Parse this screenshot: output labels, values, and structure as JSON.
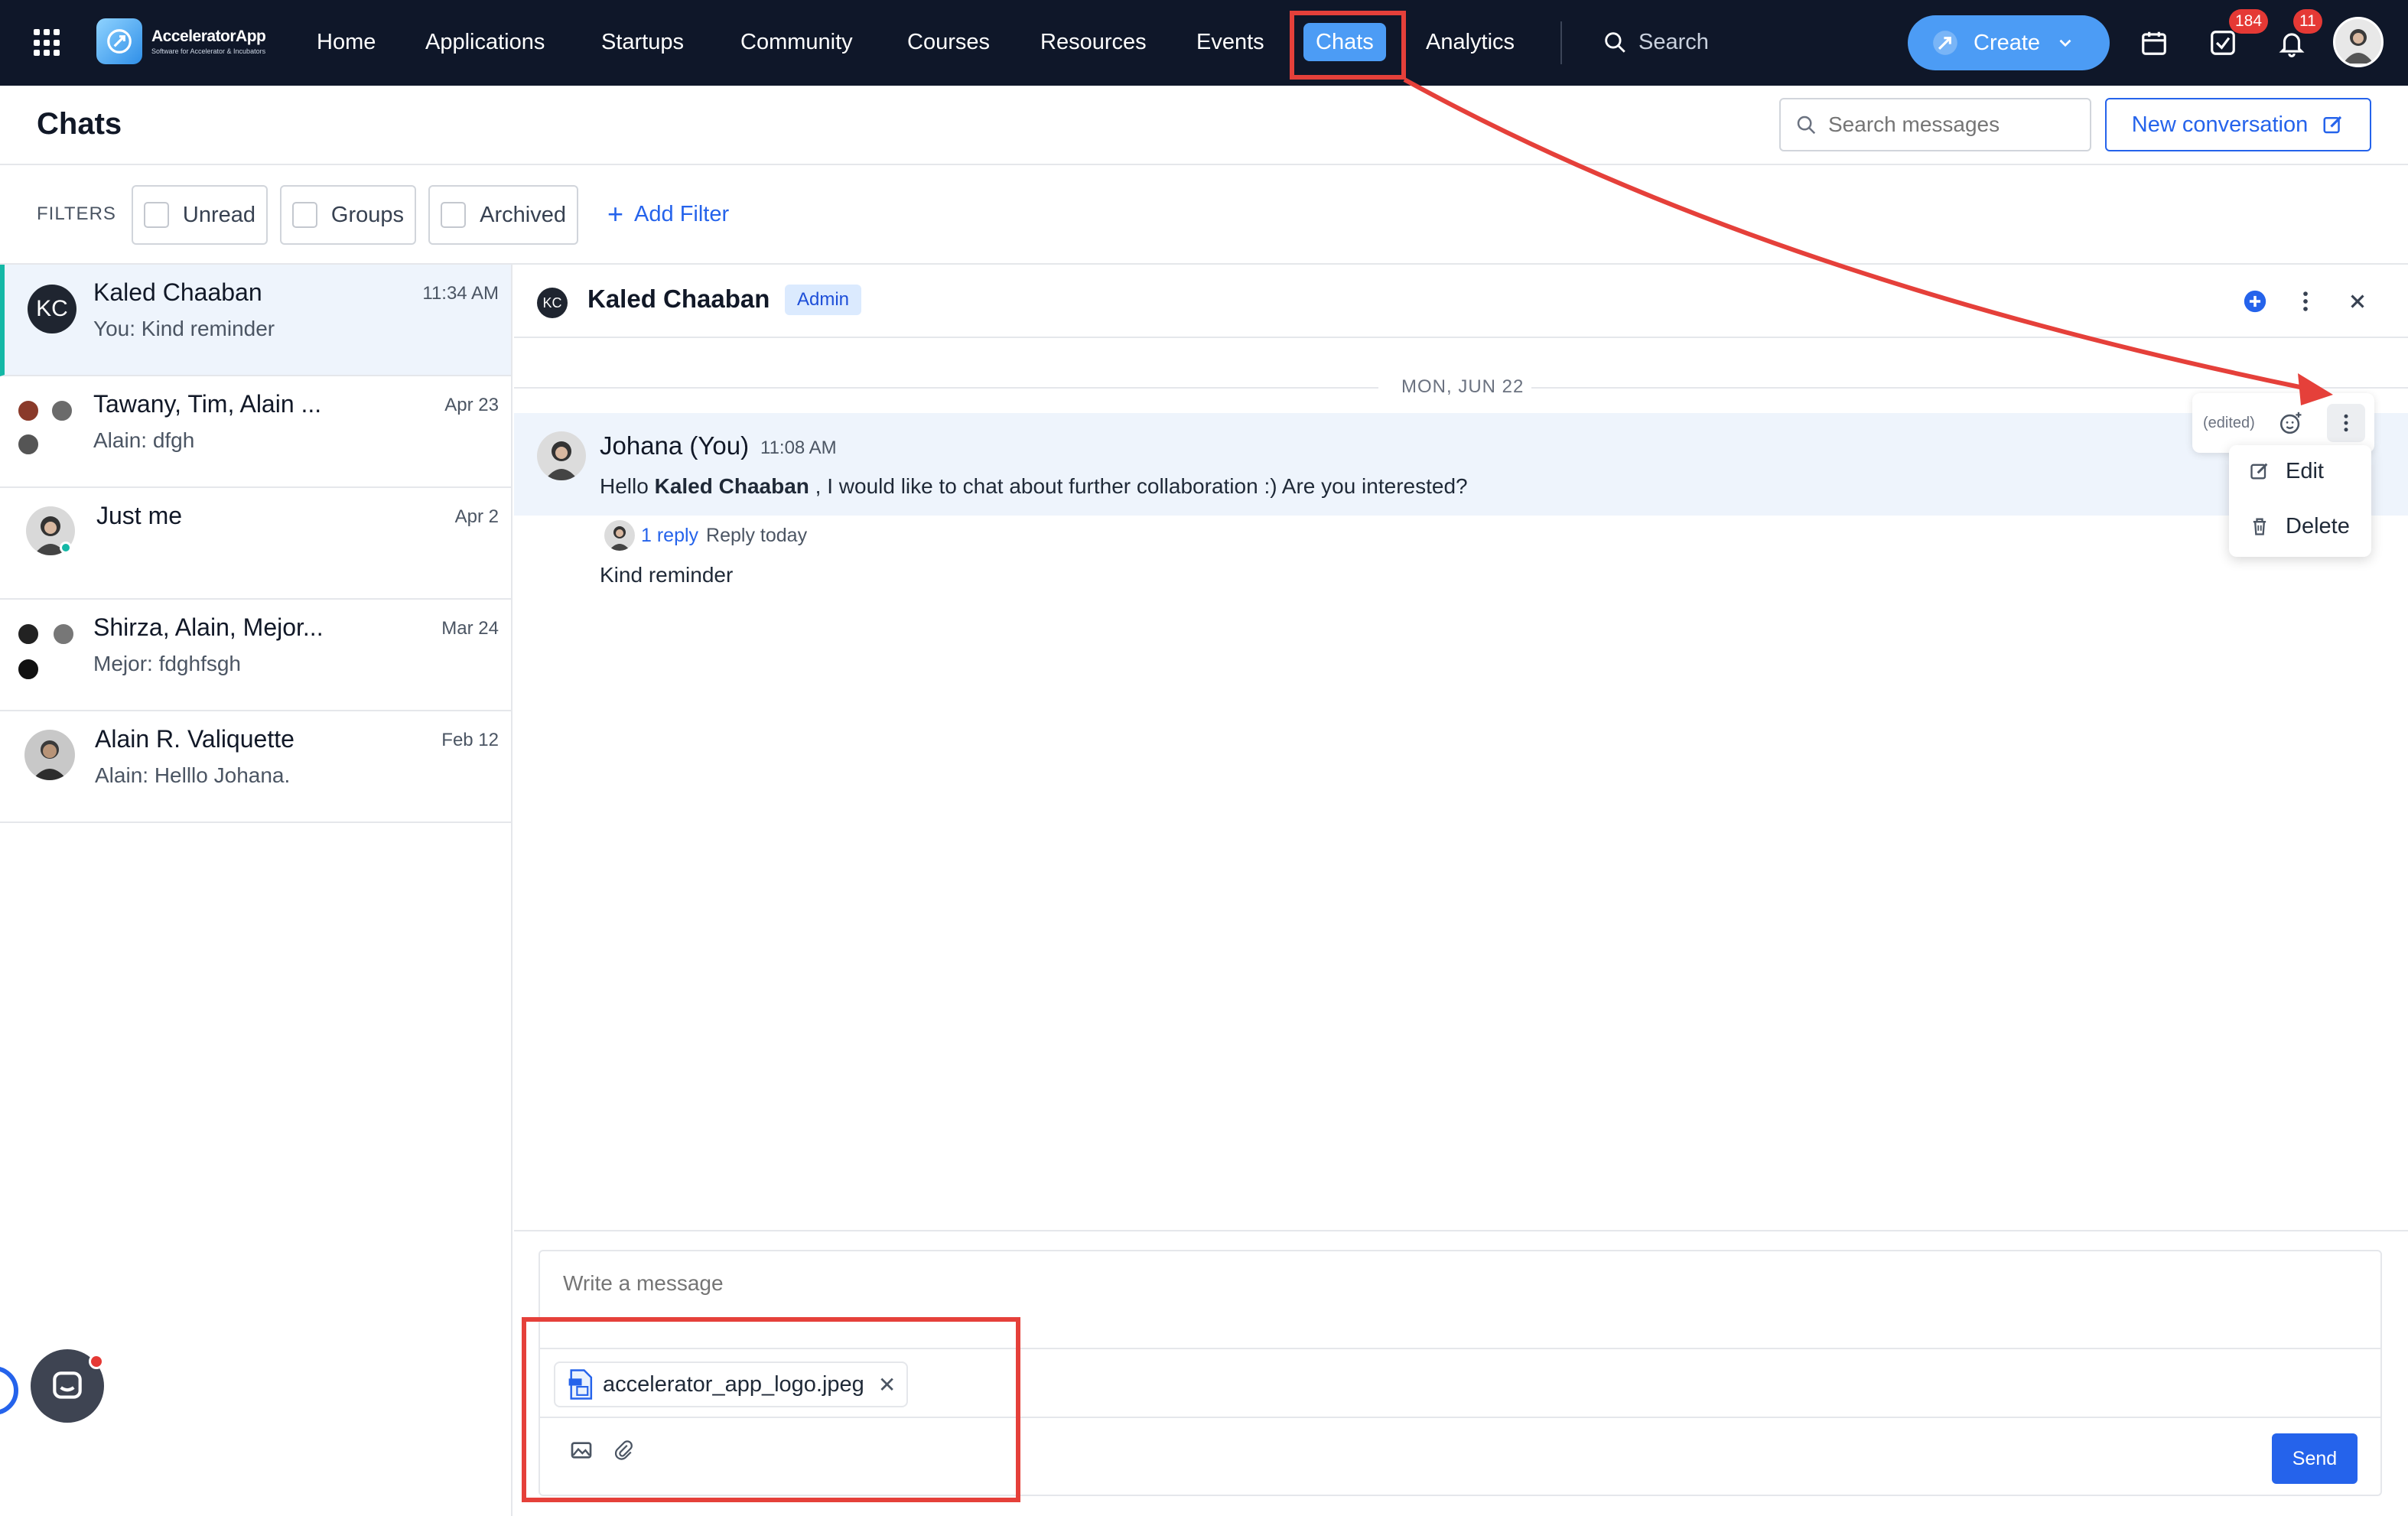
{
  "app": {
    "name": "AcceleratorApp",
    "tagline": "Software for Accelerator & Incubators"
  },
  "nav": {
    "items": [
      {
        "label": "Home"
      },
      {
        "label": "Applications"
      },
      {
        "label": "Startups"
      },
      {
        "label": "Community"
      },
      {
        "label": "Courses"
      },
      {
        "label": "Resources"
      },
      {
        "label": "Events"
      },
      {
        "label": "Chats",
        "active": true
      },
      {
        "label": "Analytics"
      }
    ],
    "search_label": "Search",
    "create_label": "Create",
    "tasks_badge": "184",
    "notifications_badge": "11"
  },
  "header": {
    "title": "Chats",
    "search_placeholder": "Search messages",
    "new_conversation_label": "New conversation"
  },
  "filters": {
    "label": "FILTERS",
    "options": [
      {
        "label": "Unread",
        "checked": false
      },
      {
        "label": "Groups",
        "checked": false
      },
      {
        "label": "Archived",
        "checked": false
      }
    ],
    "add_filter_label": "Add Filter"
  },
  "conversations": [
    {
      "name": "Kaled Chaaban",
      "preview": "You: Kind reminder",
      "date": "11:34 AM",
      "initials": "KC",
      "active": true
    },
    {
      "name": "Tawany, Tim, Alain ...",
      "preview": "Alain: dfgh",
      "date": "Apr 23"
    },
    {
      "name": "Just me",
      "preview": "",
      "date": "Apr 2"
    },
    {
      "name": "Shirza, Alain, Mejor...",
      "preview": "Mejor: fdghfsgh",
      "date": "Mar 24"
    },
    {
      "name": "Alain R. Valiquette",
      "preview": "Alain: Helllo Johana.",
      "date": "Feb 12"
    }
  ],
  "chat": {
    "contact_name": "Kaled Chaaban",
    "contact_initials": "KC",
    "role_badge": "Admin",
    "date_separator": "MON, JUN 22",
    "message": {
      "author": "Johana (You)",
      "time": "11:08 AM",
      "text_before": "Hello",
      "mention": "Kaled Chaaban",
      "text_after": ", I would like to chat about further collaboration :) Are you interested?",
      "reply_count": "1 reply",
      "reply_when": "Reply today",
      "edited_label": "(edited)"
    },
    "second_message": "Kind reminder",
    "context_menu": {
      "edit_label": "Edit",
      "delete_label": "Delete"
    }
  },
  "composer": {
    "placeholder": "Write a message",
    "attachment_name": "accelerator_app_logo.jpeg",
    "send_label": "Send"
  },
  "colors": {
    "nav_bg": "#0f1729",
    "accent": "#2563eb",
    "active_nav": "#4c9cf5",
    "annotation": "#e5403a",
    "selected_conv_border": "#14b8a6"
  }
}
